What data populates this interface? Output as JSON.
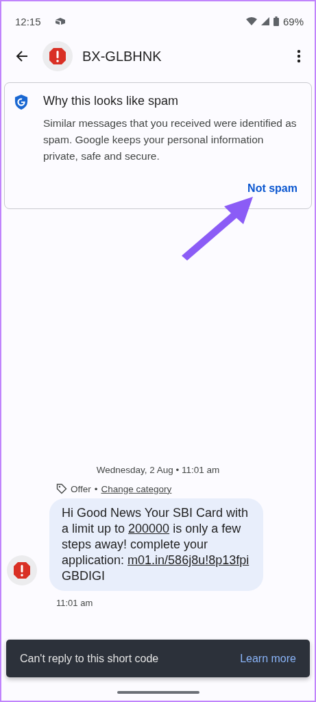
{
  "status_bar": {
    "time": "12:15",
    "battery": "69%"
  },
  "top_bar": {
    "title": "BX-GLBHNK"
  },
  "spam_card": {
    "title": "Why this looks like spam",
    "body": "Similar messages that you received were identified as spam. Google keeps your personal information private, safe and secure.",
    "action": "Not spam"
  },
  "conversation": {
    "date": "Wednesday, 2 Aug • 11:01 am",
    "category": "Offer",
    "separator": "•",
    "change_category": "Change category",
    "message": {
      "segments": [
        {
          "text": "Hi Good News Your SBI Card with a limit up to ",
          "link": false
        },
        {
          "text": "200000",
          "link": true
        },
        {
          "text": " is only a few steps away! complete your application: ",
          "link": false
        },
        {
          "text": "m01.in/586j8u!8p13fpi",
          "link": true
        },
        {
          "text": " GBDIGI",
          "link": false
        }
      ],
      "time": "11:01 am"
    }
  },
  "snackbar": {
    "text": "Can't reply to this short code",
    "action": "Learn more"
  }
}
